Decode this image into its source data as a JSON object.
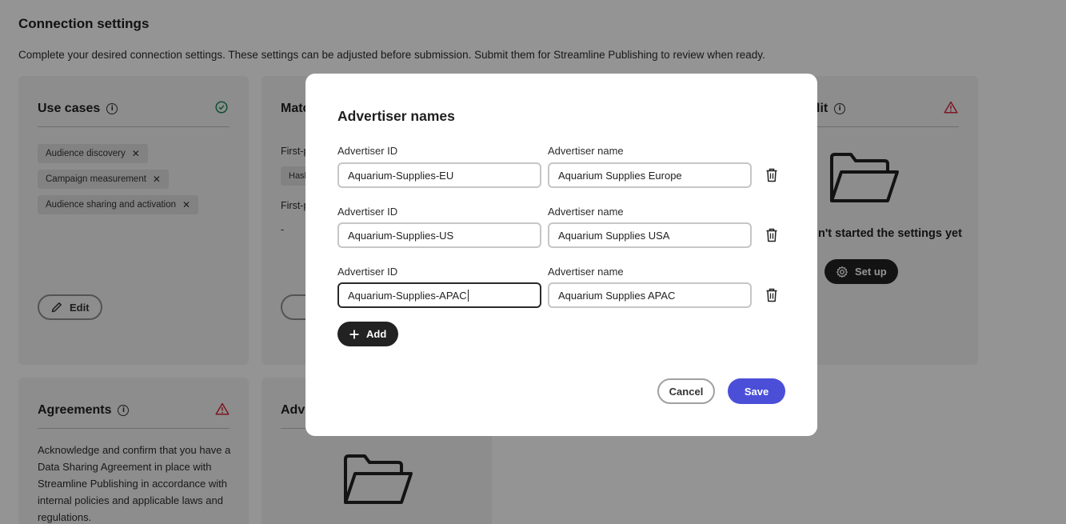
{
  "page": {
    "title": "Connection settings",
    "description": "Complete your desired connection settings. These settings can be adjusted before submission. Submit them for Streamline Publishing to review when ready."
  },
  "cards": {
    "use_cases": {
      "title": "Use cases",
      "status": "complete",
      "tags": [
        "Audience discovery",
        "Campaign measurement",
        "Audience sharing and activation"
      ],
      "edit_label": "Edit"
    },
    "match": {
      "title_partial": "Matc",
      "line1": "First-p",
      "tag_partial": "Hash",
      "line2": "First-p",
      "dash": "-"
    },
    "right": {
      "title_partial": "lit",
      "status": "warning",
      "empty_text": "n't started the settings yet",
      "setup_label": "Set up"
    },
    "agreements": {
      "title": "Agreements",
      "status": "warning",
      "text": "Acknowledge and confirm that you have a Data Sharing Agreement in place with Streamline Publishing in accordance with internal policies and applicable laws and regulations."
    },
    "advertiser": {
      "title_partial": "Adve"
    }
  },
  "modal": {
    "title": "Advertiser names",
    "id_label": "Advertiser ID",
    "name_label": "Advertiser name",
    "rows": [
      {
        "id": "Aquarium-Supplies-EU",
        "name": "Aquarium Supplies Europe"
      },
      {
        "id": "Aquarium-Supplies-US",
        "name": "Aquarium Supplies USA"
      },
      {
        "id": "Aquarium-Supplies-APAC",
        "name": "Aquarium Supplies APAC"
      }
    ],
    "add_label": "Add",
    "cancel_label": "Cancel",
    "save_label": "Save"
  },
  "colors": {
    "success": "#1a8a5a",
    "warning": "#d7263d",
    "primary": "#4b4fd8",
    "overlay": "rgba(0,0,0,0.42)"
  }
}
